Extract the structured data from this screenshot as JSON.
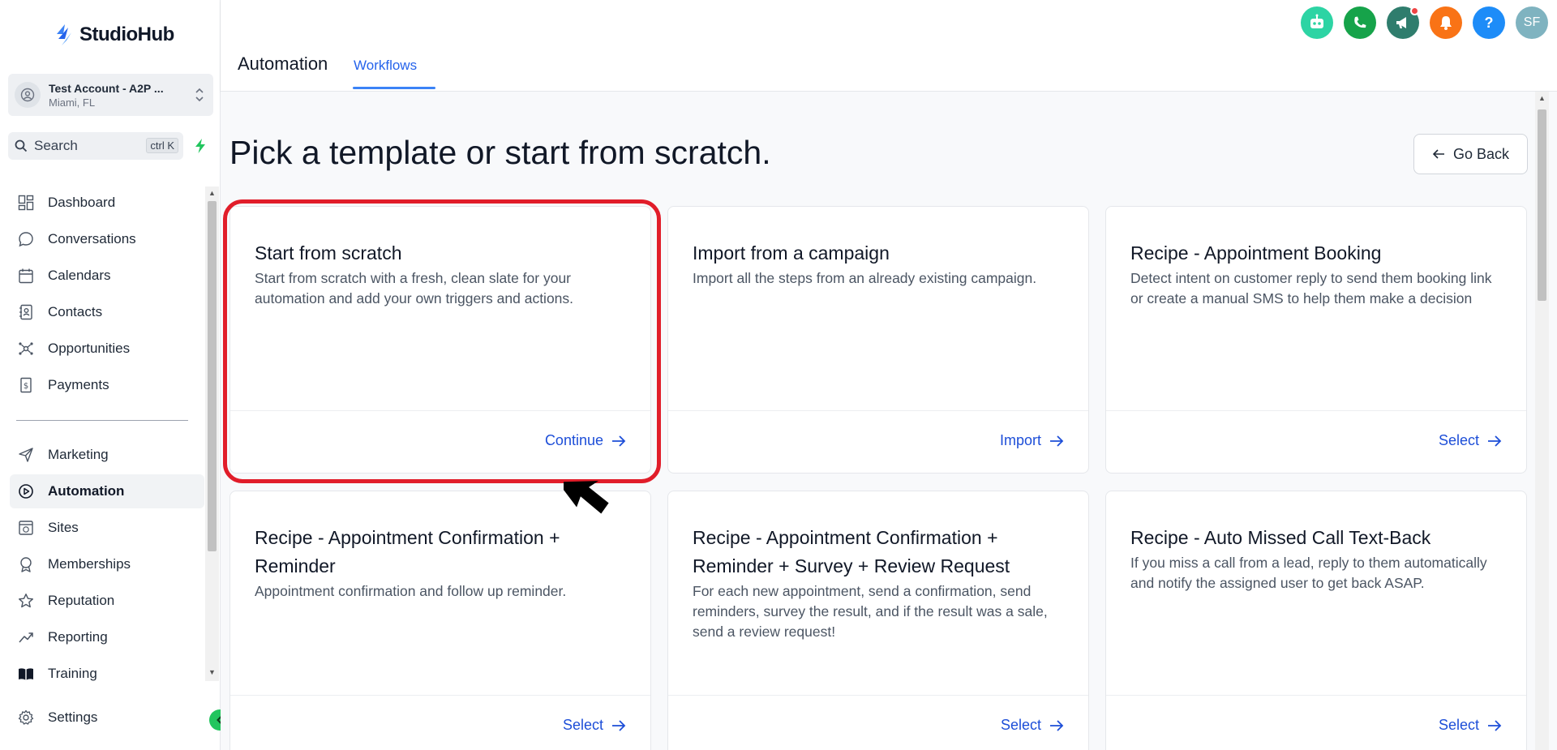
{
  "app": {
    "logo_text": "StudioHub"
  },
  "account": {
    "name": "Test Account - A2P ...",
    "location": "Miami, FL"
  },
  "search": {
    "label": "Search",
    "shortcut": "ctrl K"
  },
  "sidebar": {
    "items": [
      {
        "label": "Dashboard",
        "icon": "dashboard-icon"
      },
      {
        "label": "Conversations",
        "icon": "chat-icon"
      },
      {
        "label": "Calendars",
        "icon": "calendar-icon"
      },
      {
        "label": "Contacts",
        "icon": "contacts-icon"
      },
      {
        "label": "Opportunities",
        "icon": "opportunities-icon"
      },
      {
        "label": "Payments",
        "icon": "payments-icon"
      },
      {
        "label": "Marketing",
        "icon": "send-icon"
      },
      {
        "label": "Automation",
        "icon": "automation-icon",
        "active": true
      },
      {
        "label": "Sites",
        "icon": "sites-icon"
      },
      {
        "label": "Memberships",
        "icon": "memberships-icon"
      },
      {
        "label": "Reputation",
        "icon": "star-icon"
      },
      {
        "label": "Reporting",
        "icon": "reporting-icon"
      },
      {
        "label": "Training",
        "icon": "book-icon"
      },
      {
        "label": "Settings",
        "icon": "gear-icon"
      }
    ]
  },
  "header": {
    "title": "Automation",
    "tab": "Workflows",
    "icons": [
      {
        "name": "bot-icon",
        "color": "#2dd4a4"
      },
      {
        "name": "phone-icon",
        "color": "#16a34a"
      },
      {
        "name": "megaphone-icon",
        "color": "#2f7d6d"
      },
      {
        "name": "bell-icon",
        "color": "#f97316"
      },
      {
        "name": "help-icon",
        "color": "#1d8cf8"
      }
    ],
    "avatar_initials": "SF",
    "avatar_color": "#7fb3c0"
  },
  "main": {
    "page_title": "Pick a template or start from scratch.",
    "go_back_label": "Go Back",
    "cards": [
      {
        "title": "Start from scratch",
        "description": "Start from scratch with a fresh, clean slate for your automation and add your own triggers and actions.",
        "action": "Continue"
      },
      {
        "title": "Import from a campaign",
        "description": "Import all the steps from an already existing campaign.",
        "action": "Import"
      },
      {
        "title": "Recipe - Appointment Booking",
        "description": "Detect intent on customer reply to send them booking link or create a manual SMS to help them make a decision",
        "action": "Select"
      },
      {
        "title": "Recipe - Appointment Confirmation + Reminder",
        "description": "Appointment confirmation and follow up reminder.",
        "action": "Select"
      },
      {
        "title": "Recipe - Appointment Confirmation + Reminder + Survey + Review Request",
        "description": "For each new appointment, send a confirmation, send reminders, survey the result, and if the result was a sale, send a review request!",
        "action": "Select"
      },
      {
        "title": "Recipe - Auto Missed Call Text-Back",
        "description": "If you miss a call from a lead, reply to them automatically and notify the assigned user to get back ASAP.",
        "action": "Select"
      }
    ]
  },
  "colors": {
    "accent": "#2563eb",
    "highlight": "#e11d2a",
    "collapse": "#22c55e"
  }
}
